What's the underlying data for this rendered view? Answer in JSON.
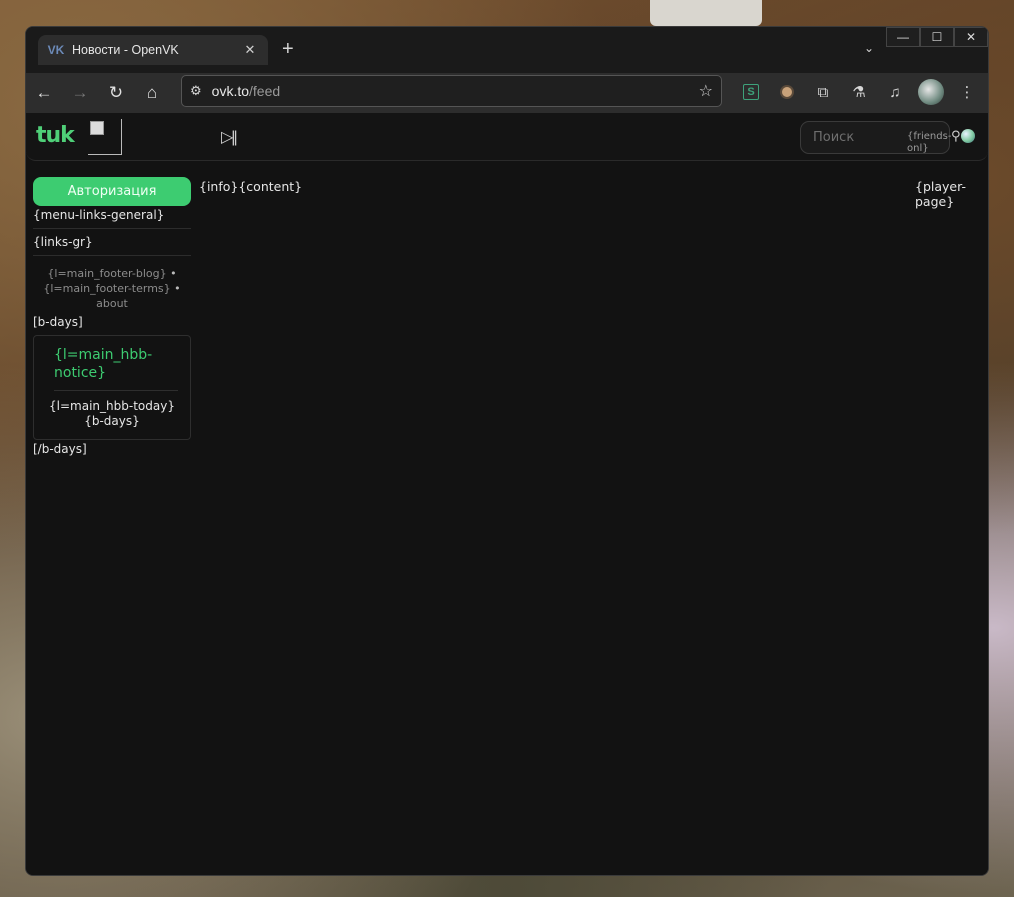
{
  "browser": {
    "tab": {
      "title": "Новости - OpenVK",
      "favicon": "vk-icon",
      "close": "✕"
    },
    "new_tab": "+",
    "tab_search": "⌄",
    "window_controls": [
      "—",
      "☐",
      "✕"
    ],
    "nav": {
      "back": "←",
      "forward": "→",
      "reload": "↻",
      "home": "⌂"
    },
    "omnibox": {
      "host": "ovk.to",
      "path": "/feed",
      "tune": "⚙",
      "star": "☆"
    },
    "extensions": {
      "flask": "⚗",
      "media": "♫",
      "puzzle": "⧉",
      "menu": "⋮"
    }
  },
  "site": {
    "logo": "tuk",
    "player_button": "▷||",
    "search_placeholder": "Поиск",
    "friends_online": "{friends-onl}",
    "user_icon": "⚲"
  },
  "sidebar": {
    "auth_button": "Авторизация",
    "menu_links_general": "{menu-links-general}",
    "links_gr": "{links-gr}",
    "footer": {
      "blog": "{l=main_footer-blog}",
      "terms": "{l=main_footer-terms}",
      "about": "about",
      "separator": "•"
    },
    "bdays_open": "[b-days]",
    "hbb": {
      "notice": "{l=main_hbb-notice}",
      "today_label": "{l=main_hbb-today}",
      "today_value": "{b-days}"
    },
    "bdays_close": "[/b-days]"
  },
  "main": {
    "content": "{info}{content}",
    "player_page": "{player-page}"
  },
  "colors": {
    "accent_green": "#3dcc71",
    "page_bg": "#121212",
    "chrome_bg": "#2d2d2d"
  }
}
